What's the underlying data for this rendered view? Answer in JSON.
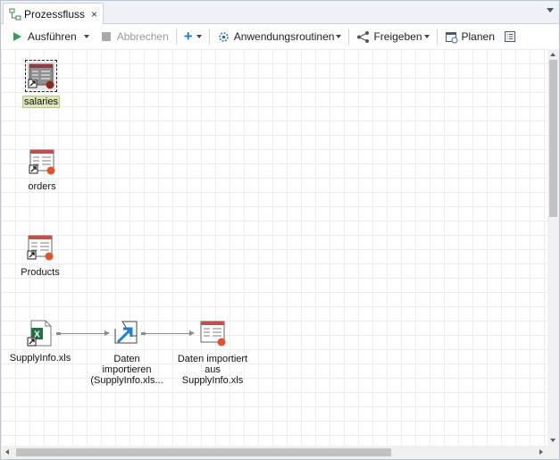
{
  "tab": {
    "label": "Prozessfluss",
    "close": "×",
    "icon": "process-flow-icon"
  },
  "toolbar": {
    "run_label": "Ausführen",
    "stop_label": "Abbrechen",
    "add_label": "+",
    "routines_label": "Anwendungsroutinen",
    "share_label": "Freigeben",
    "schedule_label": "Planen"
  },
  "nodes": {
    "salaries": {
      "label": "salaries",
      "icon": "sas-table-icon",
      "selected": true
    },
    "orders": {
      "label": "orders",
      "icon": "sas-table-icon"
    },
    "products": {
      "label": "Products",
      "icon": "sas-table-icon"
    },
    "supplyinfo": {
      "label": "SupplyInfo.xls",
      "icon": "excel-file-icon"
    },
    "import": {
      "label_1": "Daten",
      "label_2": "importieren",
      "label_3": "(SupplyInfo.xls...",
      "icon": "import-data-icon"
    },
    "imported": {
      "label_1": "Daten importiert",
      "label_2": "aus",
      "label_3": "SupplyInfo.xls",
      "icon": "sas-table-icon"
    }
  },
  "colors": {
    "accent": "#1f7fd1",
    "table_header": "#c0504d",
    "badge": "#d9552e",
    "excel_green": "#217346",
    "run_green": "#3a9a5c"
  }
}
